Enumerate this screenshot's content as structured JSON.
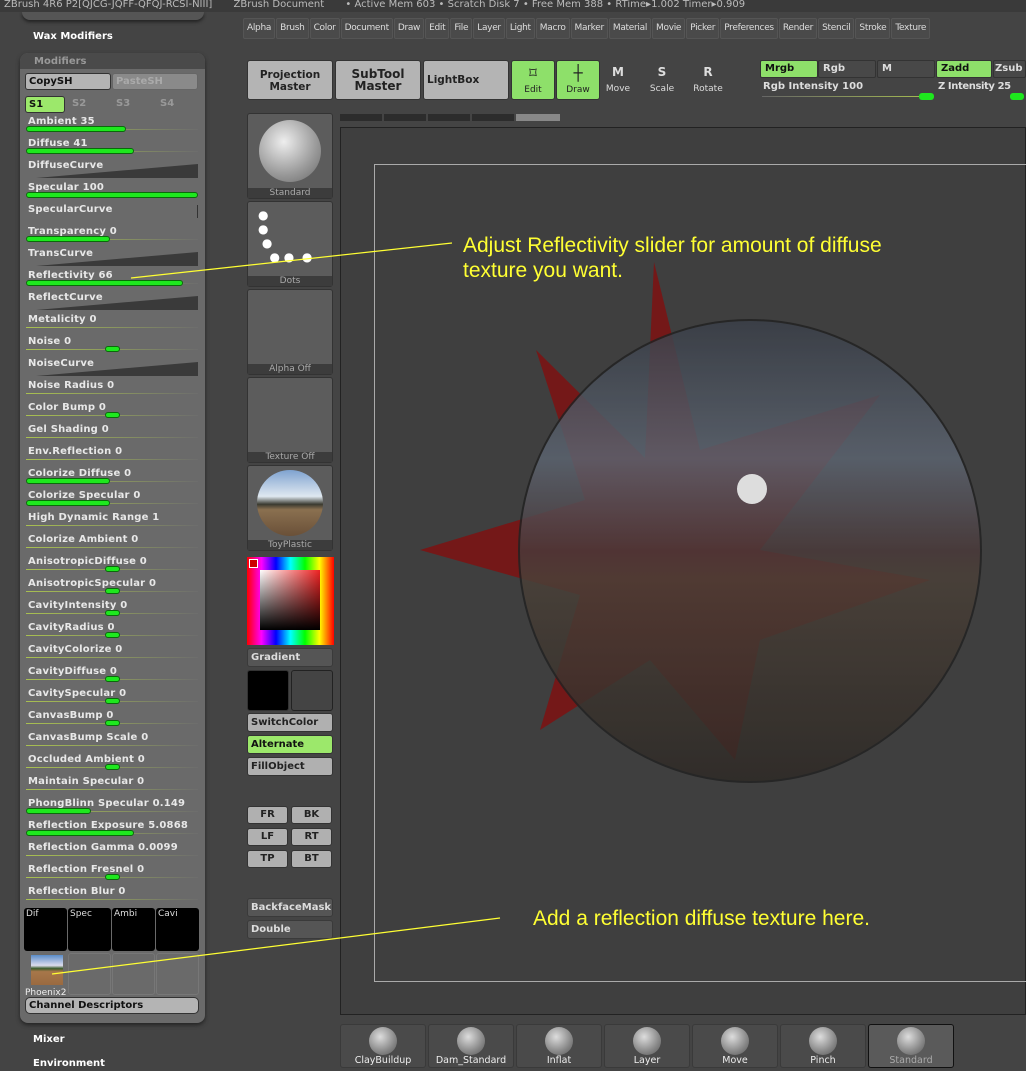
{
  "titlebar": {
    "app": "ZBrush 4R6 P2[QJCG-JQFF-QFQJ-RCSI-NIII]",
    "doc": "ZBrush Document",
    "status": "• Active Mem 603 • Scratch Disk 7 • Free Mem 388 • RTime▸1.002 Timer▸0.909"
  },
  "left": {
    "wax_modifiers": "Wax Modifiers",
    "modifiers_title": "Modifiers",
    "copy": "CopySH",
    "paste": "PasteSH",
    "slots": [
      "S1",
      "S2",
      "S3",
      "S4"
    ],
    "rows": [
      {
        "label": "Ambient 35",
        "type": "fill",
        "value": 0.58
      },
      {
        "label": "Diffuse 41",
        "type": "fill",
        "value": 0.63
      },
      {
        "label": "DiffuseCurve",
        "type": "curve"
      },
      {
        "label": "Specular 100",
        "type": "fill",
        "value": 1.0
      },
      {
        "label": "SpecularCurve",
        "type": "bar"
      },
      {
        "label": "Transparency 0",
        "type": "fill",
        "value": 0.49
      },
      {
        "label": "TransCurve",
        "type": "curve"
      },
      {
        "label": "Reflectivity 66",
        "type": "fill",
        "value": 0.91
      },
      {
        "label": "ReflectCurve",
        "type": "curve"
      },
      {
        "label": "Metalicity 0",
        "type": "line"
      },
      {
        "label": "Noise 0",
        "type": "knob",
        "value": 0.5
      },
      {
        "label": "NoiseCurve",
        "type": "curve"
      },
      {
        "label": "Noise  Radius 0",
        "type": "line"
      },
      {
        "label": "Color  Bump 0",
        "type": "knob",
        "value": 0.5
      },
      {
        "label": "Gel  Shading 0",
        "type": "line"
      },
      {
        "label": "Env.Reflection 0",
        "type": "line"
      },
      {
        "label": "Colorize  Diffuse 0",
        "type": "fill",
        "value": 0.49
      },
      {
        "label": "Colorize  Specular 0",
        "type": "fill",
        "value": 0.49
      },
      {
        "label": "High  Dynamic  Range 1",
        "type": "line"
      },
      {
        "label": "Colorize  Ambient 0",
        "type": "line"
      },
      {
        "label": "AnisotropicDiffuse 0",
        "type": "knob",
        "value": 0.5
      },
      {
        "label": "AnisotropicSpecular 0",
        "type": "knob",
        "value": 0.5
      },
      {
        "label": "CavityIntensity 0",
        "type": "knob",
        "value": 0.5
      },
      {
        "label": "CavityRadius 0",
        "type": "knob",
        "value": 0.5
      },
      {
        "label": "CavityColorize 0",
        "type": "line"
      },
      {
        "label": "CavityDiffuse 0",
        "type": "knob",
        "value": 0.5
      },
      {
        "label": "CavitySpecular 0",
        "type": "knob",
        "value": 0.5
      },
      {
        "label": "CanvasBump 0",
        "type": "knob",
        "value": 0.5
      },
      {
        "label": "CanvasBump  Scale 0",
        "type": "line"
      },
      {
        "label": "Occluded   Ambient 0",
        "type": "knob",
        "value": 0.5
      },
      {
        "label": "Maintain  Specular 0",
        "type": "line"
      },
      {
        "label": "PhongBlinn  Specular 0.149",
        "type": "fill",
        "value": 0.38
      },
      {
        "label": "Reflection  Exposure 5.0868",
        "type": "fill",
        "value": 0.63
      },
      {
        "label": "Reflection  Gamma 0.0099",
        "type": "line"
      },
      {
        "label": "Reflection  Fresnel 0",
        "type": "knob",
        "value": 0.5
      },
      {
        "label": "Reflection  Blur 0",
        "type": "line"
      }
    ],
    "channels": [
      "Dif",
      "Spec",
      "Ambi",
      "Cavi"
    ],
    "texture": "Phoenix2",
    "channel_desc": "Channel Descriptors",
    "mixer": "Mixer",
    "environment": "Environment"
  },
  "menu": [
    "Alpha",
    "Brush",
    "Color",
    "Document",
    "Draw",
    "Edit",
    "File",
    "Layer",
    "Light",
    "Macro",
    "Marker",
    "Material",
    "Movie",
    "Picker",
    "Preferences",
    "Render",
    "Stencil",
    "Stroke",
    "Texture"
  ],
  "toolbar": {
    "projection": "Projection Master",
    "subtool": "SubTool Master",
    "lightbox": "LightBox",
    "edit": "Edit",
    "draw": "Draw",
    "move": "Move",
    "scale": "Scale",
    "rotate": "Rotate",
    "mrgb": "Mrgb",
    "rgb": "Rgb",
    "m": "M",
    "zadd": "Zadd",
    "zsub": "Zsub",
    "rgb_intensity": "Rgb  Intensity 100",
    "z_intensity": "Z  Intensity 25"
  },
  "mid": {
    "thumbs": [
      "Standard",
      "Dots",
      "Alpha  Off",
      "Texture  Off",
      "ToyPlastic"
    ],
    "gradient": "Gradient",
    "switch": "SwitchColor",
    "alternate": "Alternate",
    "fill": "FillObject",
    "views": [
      "FR",
      "BK",
      "LF",
      "RT",
      "TP",
      "BT"
    ],
    "backface": "BackfaceMask",
    "double": "Double"
  },
  "notes": {
    "top": "Adjust Reflectivity slider for amount of diffuse texture you want.",
    "bottom": "Add a reflection diffuse texture here."
  },
  "brushes": [
    "ClayBuildup",
    "Dam_Standard",
    "Inflat",
    "Layer",
    "Move",
    "Pinch",
    "Standard"
  ],
  "colors": {
    "accent_green": "#1ee81e",
    "button_green": "#8ee06a",
    "annotation": "#ffff33",
    "star": "#7a1414"
  }
}
